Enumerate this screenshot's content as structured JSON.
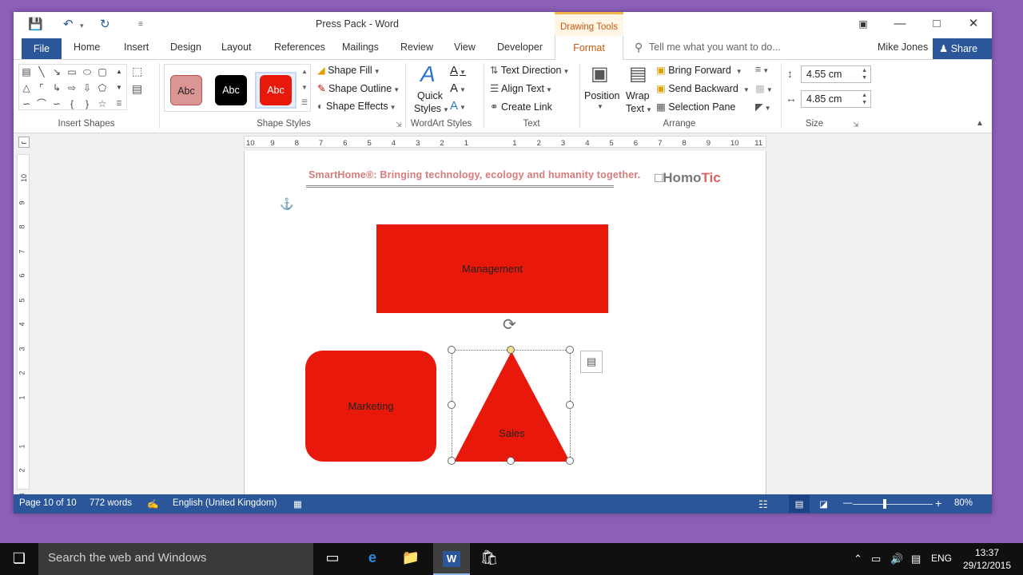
{
  "window": {
    "title": "Press Pack - Word",
    "contextual_tab": "Drawing Tools"
  },
  "qat": {
    "save_icon": "save-icon",
    "undo_icon": "undo-icon",
    "redo_icon": "redo-icon",
    "customize_icon": "customize-qat-icon"
  },
  "tabs": [
    "File",
    "Home",
    "Insert",
    "Design",
    "Layout",
    "References",
    "Mailings",
    "Review",
    "View",
    "Developer",
    "Format"
  ],
  "tell_me": "Tell me what you want to do...",
  "user": "Mike Jones",
  "share": "Share",
  "ribbon": {
    "groups": {
      "insert_shapes": "Insert Shapes",
      "shape_styles": "Shape Styles",
      "wordart_styles": "WordArt Styles",
      "text": "Text",
      "arrange": "Arrange",
      "size": "Size"
    },
    "style_swatches": [
      "Abc",
      "Abc",
      "Abc"
    ],
    "shape_fill": "Shape Fill",
    "shape_outline": "Shape Outline",
    "shape_effects": "Shape Effects",
    "quick_styles_1": "Quick",
    "quick_styles_2": "Styles",
    "text_direction": "Text Direction",
    "align_text": "Align Text",
    "create_link": "Create Link",
    "position": "Position",
    "wrap_text_1": "Wrap",
    "wrap_text_2": "Text",
    "bring_forward": "Bring Forward",
    "send_backward": "Send Backward",
    "selection_pane": "Selection Pane",
    "height": "4.55 cm",
    "width": "4.85 cm"
  },
  "ruler": {
    "h": [
      "10",
      "9",
      "8",
      "7",
      "6",
      "5",
      "4",
      "3",
      "2",
      "1",
      "",
      "1",
      "2",
      "3",
      "4",
      "5",
      "6",
      "7",
      "8",
      "9",
      "10",
      "11"
    ],
    "v": [
      "10",
      "9",
      "8",
      "7",
      "6",
      "5",
      "4",
      "3",
      "2",
      "1",
      "",
      "1",
      "2",
      "3"
    ]
  },
  "document": {
    "header_text": "SmartHome®: Bringing technology, ecology and humanity together.",
    "logo_homo": "Homo",
    "logo_tic": "Tic",
    "shapes": {
      "management": "Management",
      "marketing": "Marketing",
      "sales": "Sales"
    }
  },
  "status": {
    "page": "Page 10 of 10",
    "words": "772 words",
    "language": "English (United Kingdom)",
    "zoom": "80%"
  },
  "taskbar": {
    "search": "Search the web and Windows",
    "lang": "ENG",
    "time": "13:37",
    "date": "29/12/2015"
  },
  "colors": {
    "accent": "#2b579a",
    "shape_fill": "#e8190a",
    "contextual": "#c55a11"
  }
}
